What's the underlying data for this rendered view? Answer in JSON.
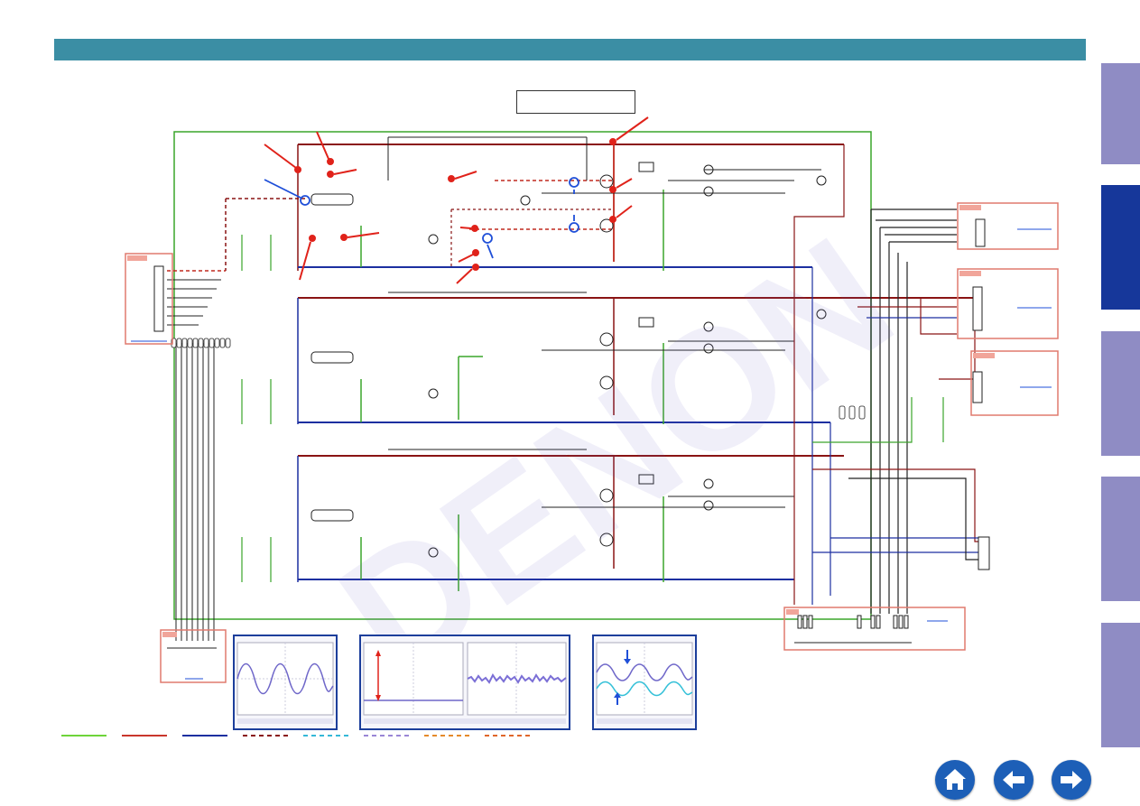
{
  "header": {
    "title": ""
  },
  "title_box": {
    "text": ""
  },
  "side_tabs": [
    {
      "id": "tab-1",
      "active": false
    },
    {
      "id": "tab-2",
      "active": true
    },
    {
      "id": "tab-3",
      "active": false
    },
    {
      "id": "tab-4",
      "active": false
    },
    {
      "id": "tab-5",
      "active": false
    }
  ],
  "nav": {
    "home_icon": "home-icon",
    "back_icon": "arrow-left-icon",
    "forward_icon": "arrow-right-icon"
  },
  "colors": {
    "header": "#3b8ea4",
    "side_tab": "#8f8cc4",
    "side_tab_active": "#16379a",
    "trace_green": "#3aa52a",
    "trace_red": "#c0281e",
    "trace_darkred": "#8a1414",
    "trace_blue": "#1c2fa0",
    "connector_box": "#e07a6e",
    "annotation_red": "#e0221a",
    "annotation_blue": "#1f4fd8",
    "scope_frame": "#1c3e9b",
    "nav_button": "#1d5fb7"
  },
  "legend": [
    {
      "color": "#6ed43a",
      "style": "solid"
    },
    {
      "color": "#c9362b",
      "style": "solid"
    },
    {
      "color": "#1c2fa0",
      "style": "solid"
    },
    {
      "color": "#8a1414",
      "style": "dashed"
    },
    {
      "color": "#34b8d8",
      "style": "dashed"
    },
    {
      "color": "#9a86d6",
      "style": "dashed"
    },
    {
      "color": "#e58a2a",
      "style": "dashed"
    },
    {
      "color": "#e0662a",
      "style": "dashed"
    }
  ]
}
